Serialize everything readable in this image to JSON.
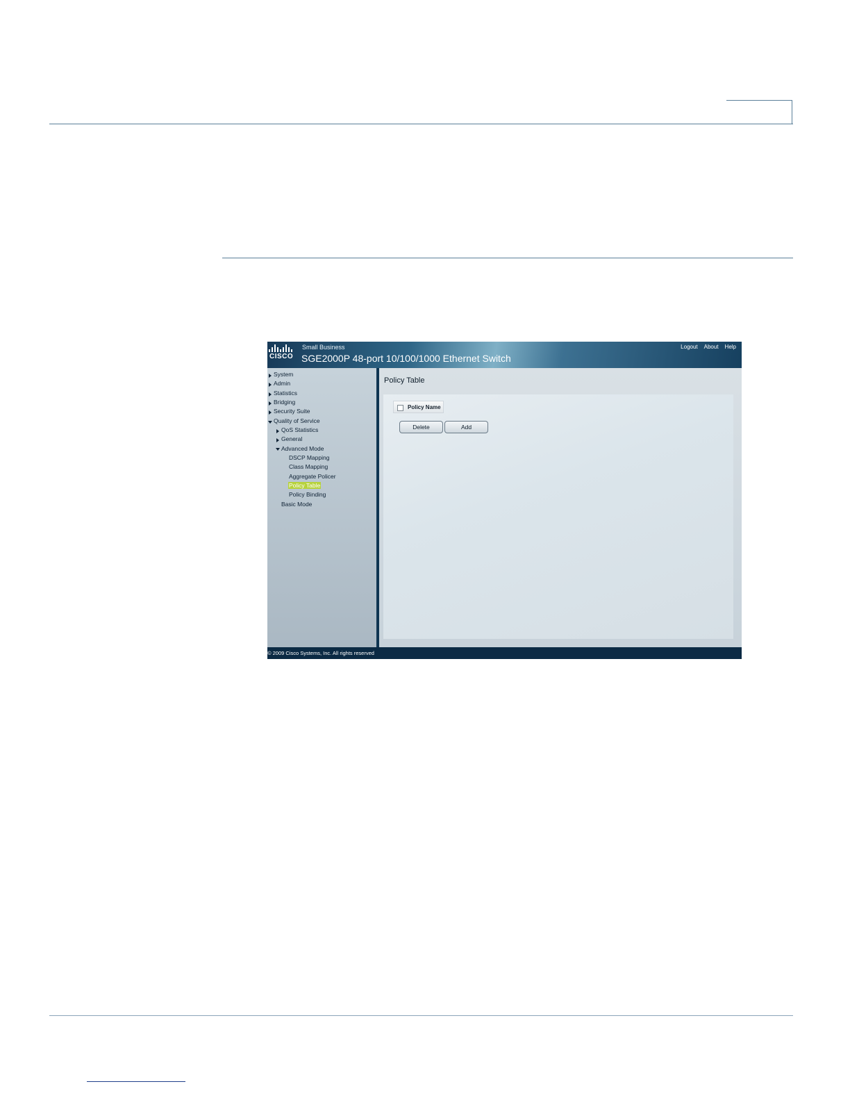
{
  "app": {
    "brand_word": "CISCO",
    "brand_small": "Small Business",
    "title": "SGE2000P 48-port 10/100/1000 Ethernet Switch",
    "top_links": [
      "Logout",
      "About",
      "Help"
    ],
    "footer": "© 2009 Cisco Systems, Inc. All rights reserved"
  },
  "sidebar": {
    "items": [
      {
        "label": "System"
      },
      {
        "label": "Admin"
      },
      {
        "label": "Statistics"
      },
      {
        "label": "Bridging"
      },
      {
        "label": "Security Suite"
      },
      {
        "label": "Quality of Service"
      },
      {
        "label": "QoS Statistics"
      },
      {
        "label": "General"
      },
      {
        "label": "Advanced Mode"
      },
      {
        "label": "DSCP Mapping"
      },
      {
        "label": "Class Mapping"
      },
      {
        "label": "Aggregate Policer"
      },
      {
        "label": "Policy Table"
      },
      {
        "label": "Policy Binding"
      },
      {
        "label": "Basic Mode"
      }
    ]
  },
  "main": {
    "page_title": "Policy Table",
    "table": {
      "column": "Policy Name",
      "select_all_checked": false
    },
    "buttons": {
      "delete": "Delete",
      "add": "Add"
    }
  },
  "colors": {
    "active_nav": "#b7d23c",
    "frame": "#0b2a44"
  }
}
